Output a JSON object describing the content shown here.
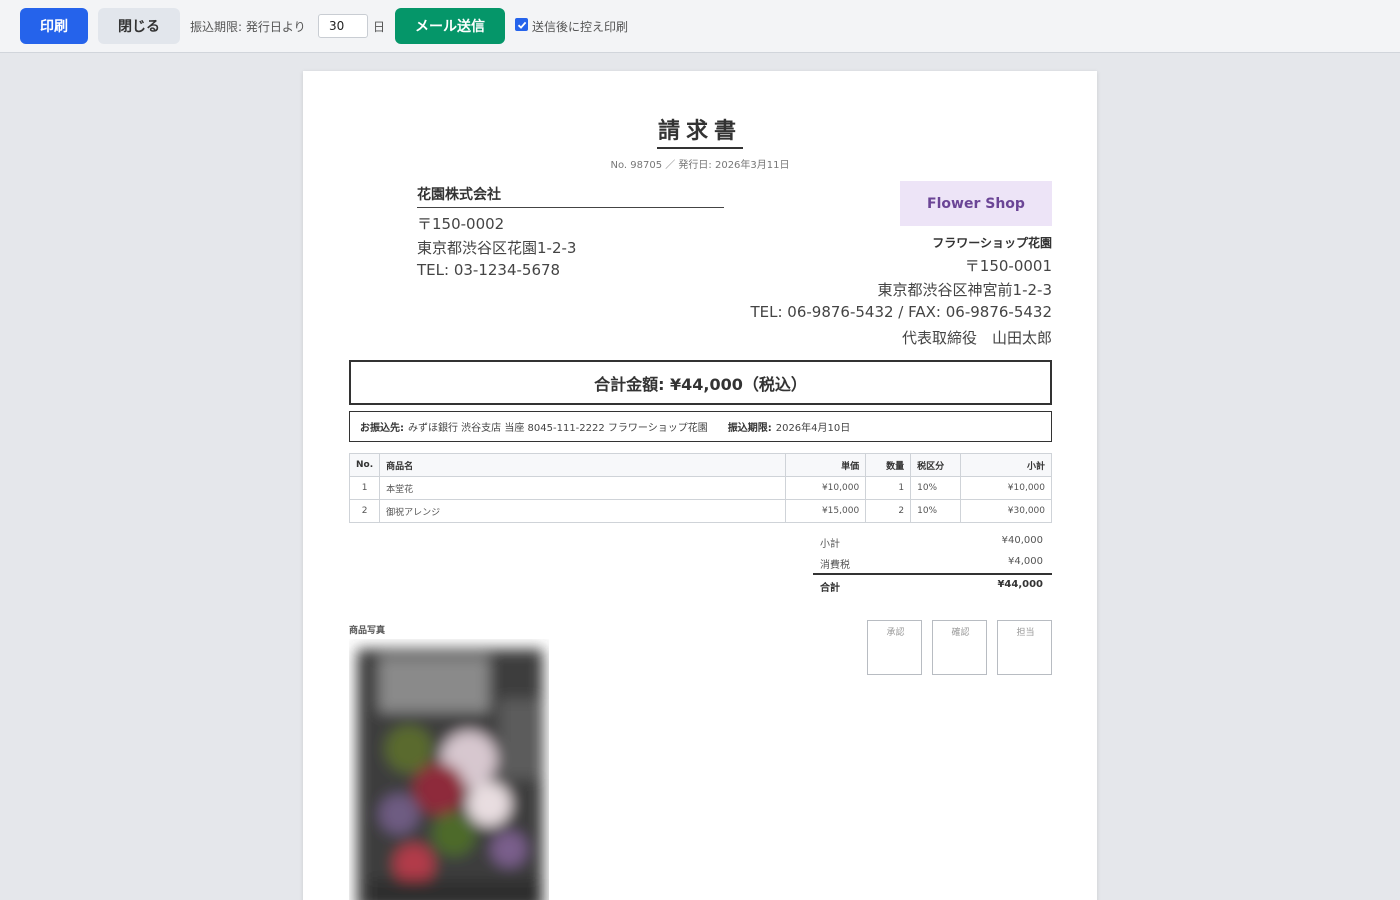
{
  "toolbar": {
    "print_label": "印刷",
    "close_label": "閉じる",
    "due_label": "振込期限: 発行日より",
    "due_days": "30",
    "days_unit": "日",
    "mail_label": "メール送信",
    "copy_print_label": "送信後に控え印刷",
    "copy_print_checked": true
  },
  "invoice": {
    "title": "請求書",
    "meta": "No. 98705 ／ 発行日: 2026年3月11日",
    "client": {
      "name": "花園株式会社",
      "postal": "〒150-0002",
      "address": "東京都渋谷区花園1-2-3",
      "tel": "TEL: 03-1234-5678"
    },
    "issuer": {
      "logo_text": "Flower Shop",
      "name": "フラワーショップ花園",
      "postal": "〒150-0001",
      "address": "東京都渋谷区神宮前1-2-3",
      "tel_fax": "TEL: 06-9876-5432 / FAX: 06-9876-5432",
      "representative": "代表取締役　山田太郎"
    },
    "total_banner": "合計金額: ¥44,000（税込）",
    "bank": {
      "label": "お振込先:",
      "text": "みずほ銀行 渋谷支店 当座 8045-111-2222 フラワーショップ花園",
      "due_label": "振込期限:",
      "due_date": "2026年4月10日"
    },
    "table": {
      "headers": [
        "No.",
        "商品名",
        "単価",
        "数量",
        "税区分",
        "小計"
      ],
      "rows": [
        [
          "1",
          "本堂花",
          "¥10,000",
          "1",
          "10%",
          "¥10,000"
        ],
        [
          "2",
          "御祝アレンジ",
          "¥15,000",
          "2",
          "10%",
          "¥30,000"
        ]
      ]
    },
    "summary": {
      "subtotal_label": "小計",
      "subtotal_value": "¥40,000",
      "tax_label": "消費税",
      "tax_value": "¥4,000",
      "total_label": "合計",
      "total_value": "¥44,000"
    },
    "photo_label": "商品写真",
    "stamps": [
      "承認",
      "確認",
      "担当"
    ]
  }
}
